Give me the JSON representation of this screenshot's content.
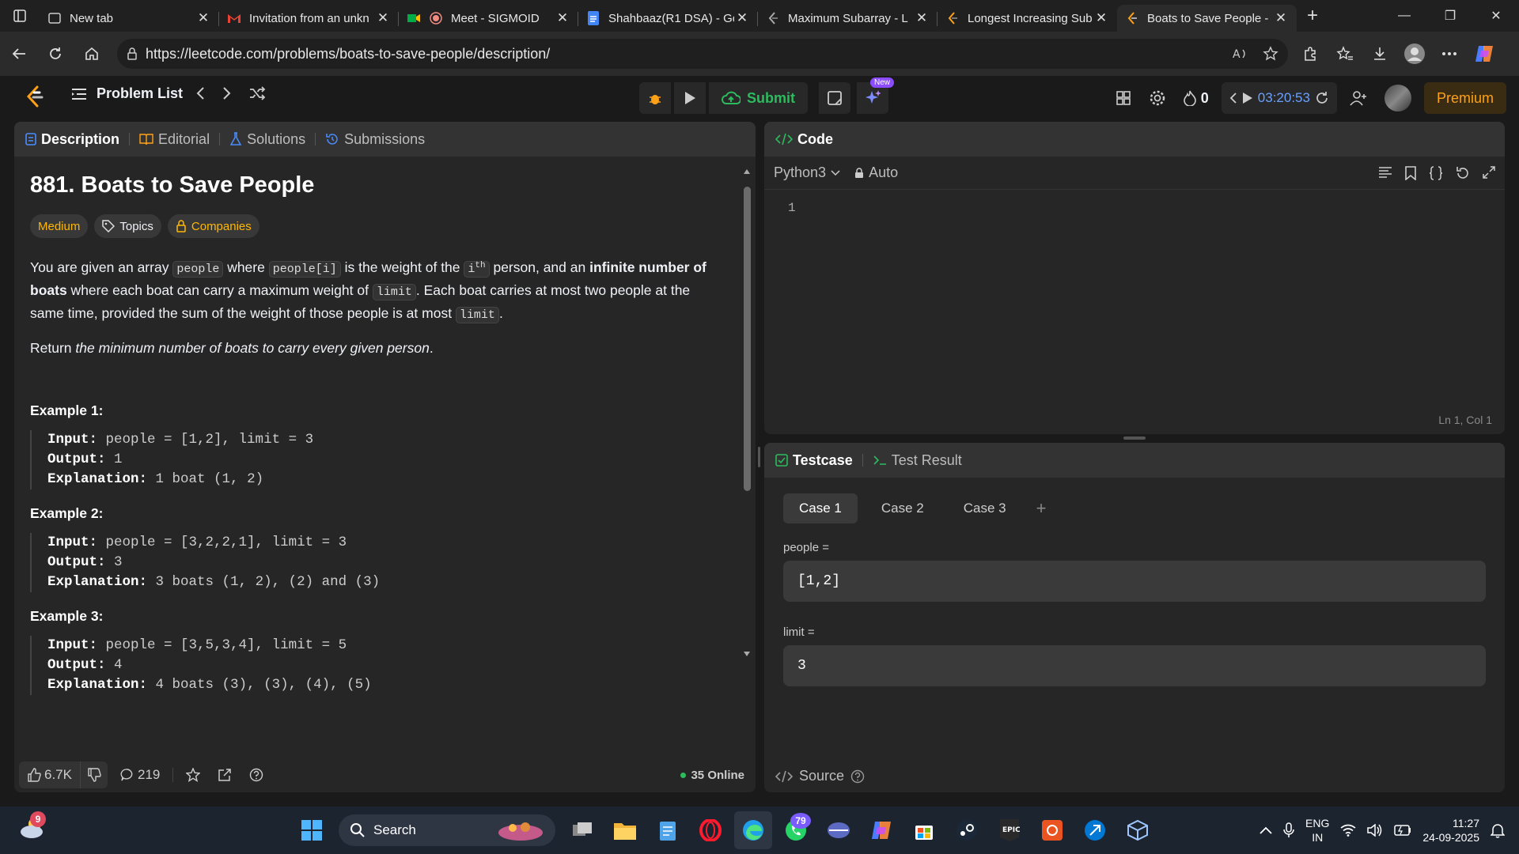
{
  "browser": {
    "tabs": [
      {
        "title": "New tab",
        "active": false
      },
      {
        "title": "Invitation from an unkn",
        "active": false
      },
      {
        "title": "Meet - SIGMOID",
        "active": false
      },
      {
        "title": "Shahbaaz(R1 DSA) - Go",
        "active": false
      },
      {
        "title": "Maximum Subarray - L",
        "active": false
      },
      {
        "title": "Longest Increasing Sub",
        "active": false
      },
      {
        "title": "Boats to Save People -",
        "active": true
      }
    ],
    "url": "https://leetcode.com/problems/boats-to-save-people/description/"
  },
  "lc_header": {
    "problem_list": "Problem List",
    "submit": "Submit",
    "new_badge": "New",
    "streak": "0",
    "timer": "03:20:53",
    "premium": "Premium"
  },
  "description": {
    "tabs": [
      "Description",
      "Editorial",
      "Solutions",
      "Submissions"
    ],
    "title": "881. Boats to Save People",
    "difficulty": "Medium",
    "topics": "Topics",
    "companies": "Companies",
    "p1_a": "You are given an array ",
    "p1_code1": "people",
    "p1_b": " where ",
    "p1_code2": "people[i]",
    "p1_c": " is the weight of the ",
    "p1_i": "i",
    "p1_sup": "th",
    "p1_d": " person, and an ",
    "p1_bold": "infinite number of boats",
    "p1_e": " where each boat can carry a maximum weight of ",
    "p1_code3": "limit",
    "p1_f": ". Each boat carries at most two people at the same time, provided the sum of the weight of those people is at most ",
    "p1_code4": "limit",
    "p1_g": ".",
    "ret_a": "Return ",
    "ret_i": "the minimum number of boats to carry every given person",
    "ret_b": ".",
    "examples": [
      {
        "title": "Example 1:",
        "input": "people = [1,2], limit = 3",
        "output": "1",
        "explanation": "1 boat (1, 2)"
      },
      {
        "title": "Example 2:",
        "input": "people = [3,2,2,1], limit = 3",
        "output": "3",
        "explanation": "3 boats (1, 2), (2) and (3)"
      },
      {
        "title": "Example 3:",
        "input": "people = [3,5,3,4], limit = 5",
        "output": "4",
        "explanation": "4 boats (3), (3), (4), (5)"
      }
    ],
    "labels": {
      "input": "Input:",
      "output": "Output:",
      "explanation": "Explanation:"
    },
    "likes": "6.7K",
    "comments": "219",
    "online": "35 Online"
  },
  "code": {
    "header": "Code",
    "language": "Python3",
    "auto": "Auto",
    "line1": "1",
    "cursor": "Ln 1, Col 1"
  },
  "testcase": {
    "tab_testcase": "Testcase",
    "tab_result": "Test Result",
    "cases": [
      "Case 1",
      "Case 2",
      "Case 3"
    ],
    "people_label": "people =",
    "people_value": "[1,2]",
    "limit_label": "limit =",
    "limit_value": "3",
    "source": "Source"
  },
  "taskbar": {
    "weather_badge": "9",
    "search": "Search",
    "whatsapp_badge": "79",
    "lang1": "ENG",
    "lang2": "IN",
    "time": "11:27",
    "date": "24-09-2025"
  }
}
